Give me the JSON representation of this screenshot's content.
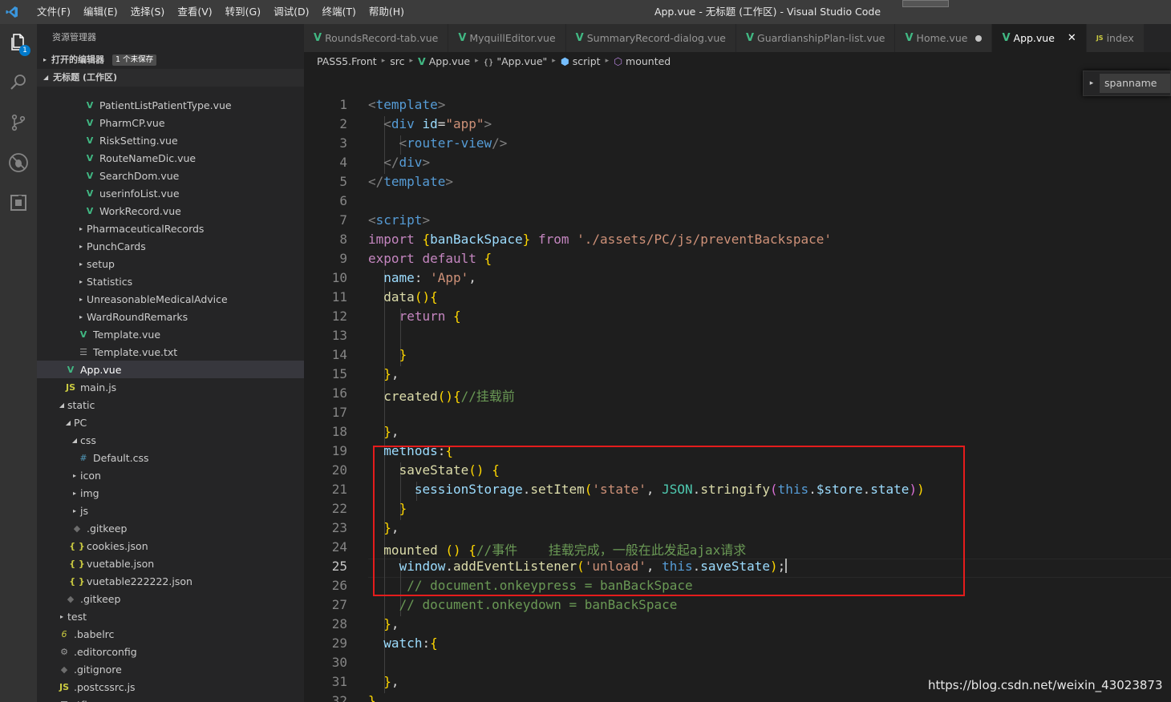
{
  "window": {
    "title": "App.vue - 无标题 (工作区) - Visual Studio Code",
    "menu": [
      "文件(F)",
      "编辑(E)",
      "选择(S)",
      "查看(V)",
      "转到(G)",
      "调试(D)",
      "终端(T)",
      "帮助(H)"
    ]
  },
  "activity": {
    "explorer_badge": "1"
  },
  "sidebar": {
    "header": "资源管理器",
    "open_editors": "打开的编辑器",
    "unsaved": "1 个未保存",
    "workspace": "无标题 (工作区)",
    "tree": [
      {
        "label": "PatientListPatientType.vue",
        "icon": "vue",
        "indent": 58,
        "arrow": ""
      },
      {
        "label": "PharmCP.vue",
        "icon": "vue",
        "indent": 58,
        "arrow": ""
      },
      {
        "label": "RiskSetting.vue",
        "icon": "vue",
        "indent": 58,
        "arrow": ""
      },
      {
        "label": "RouteNameDic.vue",
        "icon": "vue",
        "indent": 58,
        "arrow": ""
      },
      {
        "label": "SearchDom.vue",
        "icon": "vue",
        "indent": 58,
        "arrow": ""
      },
      {
        "label": "userinfoList.vue",
        "icon": "vue",
        "indent": 58,
        "arrow": ""
      },
      {
        "label": "WorkRecord.vue",
        "icon": "vue",
        "indent": 58,
        "arrow": ""
      },
      {
        "label": "PharmaceuticalRecords",
        "icon": "",
        "indent": 50,
        "arrow": "▸"
      },
      {
        "label": "PunchCards",
        "icon": "",
        "indent": 50,
        "arrow": "▸"
      },
      {
        "label": "setup",
        "icon": "",
        "indent": 50,
        "arrow": "▸"
      },
      {
        "label": "Statistics",
        "icon": "",
        "indent": 50,
        "arrow": "▸"
      },
      {
        "label": "UnreasonableMedicalAdvice",
        "icon": "",
        "indent": 50,
        "arrow": "▸"
      },
      {
        "label": "WardRoundRemarks",
        "icon": "",
        "indent": 50,
        "arrow": "▸"
      },
      {
        "label": "Template.vue",
        "icon": "vue",
        "indent": 50,
        "arrow": ""
      },
      {
        "label": "Template.vue.txt",
        "icon": "txt",
        "indent": 50,
        "arrow": ""
      },
      {
        "label": "App.vue",
        "icon": "vue",
        "indent": 34,
        "arrow": "",
        "selected": true
      },
      {
        "label": "main.js",
        "icon": "js",
        "indent": 34,
        "arrow": ""
      },
      {
        "label": "static",
        "icon": "",
        "indent": 26,
        "arrow": "◢"
      },
      {
        "label": "PC",
        "icon": "",
        "indent": 34,
        "arrow": "◢"
      },
      {
        "label": "css",
        "icon": "",
        "indent": 42,
        "arrow": "◢"
      },
      {
        "label": "Default.css",
        "icon": "css",
        "indent": 50,
        "arrow": ""
      },
      {
        "label": "icon",
        "icon": "",
        "indent": 42,
        "arrow": "▸"
      },
      {
        "label": "img",
        "icon": "",
        "indent": 42,
        "arrow": "▸"
      },
      {
        "label": "js",
        "icon": "",
        "indent": 42,
        "arrow": "▸"
      },
      {
        "label": ".gitkeep",
        "icon": "gitk",
        "indent": 42,
        "arrow": ""
      },
      {
        "label": "cookies.json",
        "icon": "json",
        "indent": 42,
        "arrow": ""
      },
      {
        "label": "vuetable.json",
        "icon": "json",
        "indent": 42,
        "arrow": ""
      },
      {
        "label": "vuetable222222.json",
        "icon": "json",
        "indent": 42,
        "arrow": ""
      },
      {
        "label": ".gitkeep",
        "icon": "gitk",
        "indent": 34,
        "arrow": ""
      },
      {
        "label": "test",
        "icon": "",
        "indent": 26,
        "arrow": "▸"
      },
      {
        "label": ".babelrc",
        "icon": "babel",
        "indent": 26,
        "arrow": ""
      },
      {
        "label": ".editorconfig",
        "icon": "gear",
        "indent": 26,
        "arrow": ""
      },
      {
        "label": ".gitignore",
        "icon": "gitk",
        "indent": 26,
        "arrow": ""
      },
      {
        "label": ".postcssrc.js",
        "icon": "js",
        "indent": 26,
        "arrow": ""
      },
      {
        "label": ".tfignore",
        "icon": "txt",
        "indent": 26,
        "arrow": ""
      }
    ]
  },
  "tabs": [
    {
      "label": "RoundsRecord-tab.vue",
      "icon": "vue"
    },
    {
      "label": "MyquillEditor.vue",
      "icon": "vue"
    },
    {
      "label": "SummaryRecord-dialog.vue",
      "icon": "vue"
    },
    {
      "label": "GuardianshipPlan-list.vue",
      "icon": "vue"
    },
    {
      "label": "Home.vue",
      "icon": "vue",
      "dirty": true
    },
    {
      "label": "App.vue",
      "icon": "vue",
      "active": true
    },
    {
      "label": "index",
      "icon": "js"
    }
  ],
  "breadcrumb": [
    "PASS5.Front",
    "src",
    "App.vue",
    "\"App.vue\"",
    "script",
    "mounted"
  ],
  "outline": {
    "value": "spanname"
  },
  "editor": {
    "current_line": 25,
    "lines": [
      "<template>",
      "  <div id=\"app\">",
      "    <router-view/>",
      "  </div>",
      "</template>",
      "",
      "<script>",
      "import {banBackSpace} from './assets/PC/js/preventBackspace'",
      "export default {",
      "  name: 'App',",
      "  data(){",
      "    return {",
      "",
      "    }",
      "  },",
      "  created(){//挂载前",
      "",
      "  },",
      "  methods:{",
      "    saveState() {",
      "      sessionStorage.setItem('state', JSON.stringify(this.$store.state))",
      "    }",
      "  },",
      "  mounted () {//事件    挂载完成，一般在此发起ajax请求",
      "    window.addEventListener('unload', this.saveState);",
      "     // document.onkeypress = banBackSpace",
      "    // document.onkeydown = banBackSpace",
      "  },",
      "  watch:{",
      "",
      "  },",
      "}"
    ]
  },
  "watermark": "https://blog.csdn.net/weixin_43023873"
}
